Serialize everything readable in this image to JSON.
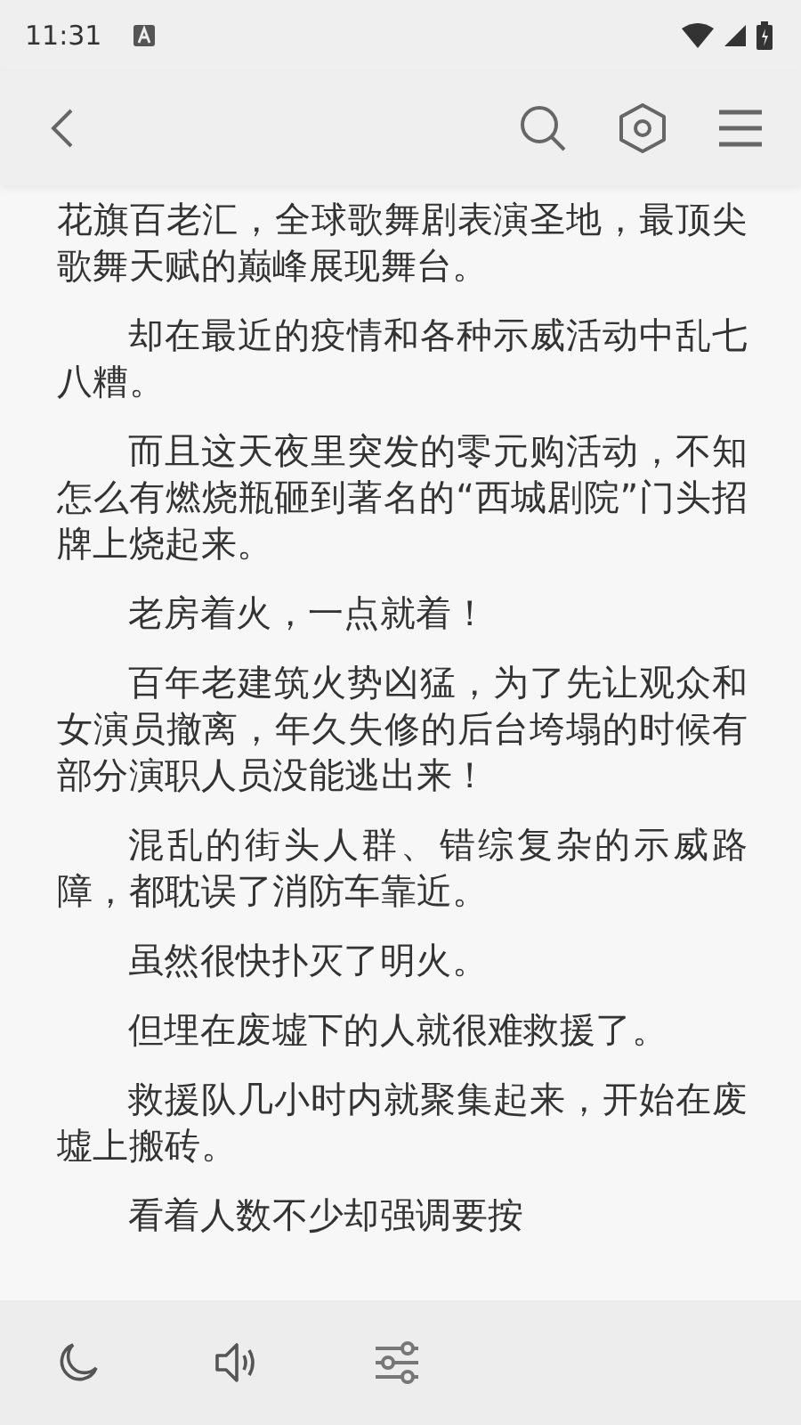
{
  "status_bar": {
    "time": "11:31"
  },
  "paragraphs": [
    {
      "kind": "continuation",
      "text": "花旗百老汇，全球歌舞剧表演圣地，最顶尖歌舞天赋的巅峰展现舞台。"
    },
    {
      "kind": "paragraph",
      "text": "却在最近的疫情和各种示威活动中乱七八糟。"
    },
    {
      "kind": "paragraph",
      "text": "而且这天夜里突发的零元购活动，不知怎么有燃烧瓶砸到著名的“西城剧院”门头招牌上烧起来。"
    },
    {
      "kind": "paragraph",
      "text": "老房着火，一点就着！"
    },
    {
      "kind": "paragraph",
      "text": "百年老建筑火势凶猛，为了先让观众和女演员撤离，年久失修的后台垮塌的时候有部分演职人员没能逃出来！"
    },
    {
      "kind": "paragraph",
      "text": "混乱的街头人群、错综复杂的示威路障，都耽误了消防车靠近。"
    },
    {
      "kind": "paragraph",
      "text": "虽然很快扑灭了明火。"
    },
    {
      "kind": "paragraph",
      "text": "但埋在废墟下的人就很难救援了。"
    },
    {
      "kind": "paragraph",
      "text": "救援队几小时内就聚集起来，开始在废墟上搬砖。"
    },
    {
      "kind": "paragraph",
      "text": "看着人数不少却强调要按"
    }
  ]
}
